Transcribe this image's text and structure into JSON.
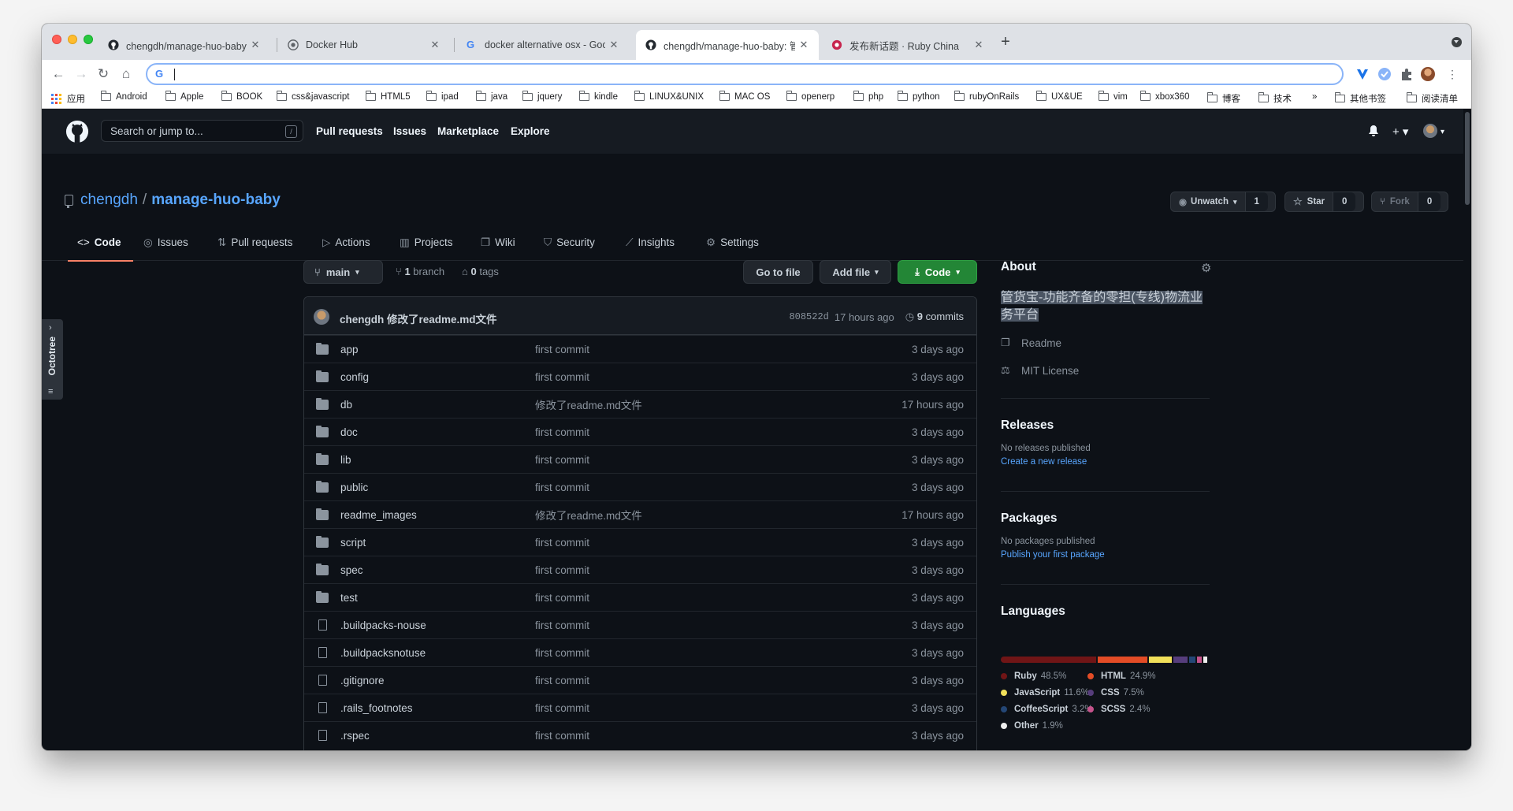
{
  "browser": {
    "tabs": [
      {
        "title": "chengdh/manage-huo-baby: 管货宝",
        "icon": "github-icon",
        "active": false
      },
      {
        "title": "Docker Hub",
        "icon": "docker-icon",
        "active": false
      },
      {
        "title": "docker alternative osx - Google",
        "icon": "google-icon",
        "active": false
      },
      {
        "title": "chengdh/manage-huo-baby: 管货宝",
        "icon": "github-icon",
        "active": true
      },
      {
        "title": "发布新话题 · Ruby China",
        "icon": "ruby-china-icon",
        "active": false
      }
    ],
    "new_tab": "+",
    "address_value": "",
    "bookmarks": [
      "应用",
      "Android",
      "Apple",
      "BOOK",
      "css&javascript",
      "HTML5",
      "ipad",
      "java",
      "jquery",
      "kindle",
      "LINUX&UNIX",
      "MAC OS",
      "openerp",
      "php",
      "python",
      "rubyOnRails",
      "UX&UE",
      "vim",
      "xbox360",
      "博客",
      "技术"
    ],
    "bookmarks_overflow": "»",
    "other_bookmarks": "其他书签",
    "reading_list": "阅读清单"
  },
  "gh": {
    "search_placeholder": "Search or jump to...",
    "search_key": "/",
    "nav": [
      "Pull requests",
      "Issues",
      "Marketplace",
      "Explore"
    ]
  },
  "repo": {
    "owner": "chengdh",
    "sep": "/",
    "name": "manage-huo-baby",
    "unwatch_label": "Unwatch",
    "watch_count": "1",
    "star_label": "Star",
    "star_count": "0",
    "fork_label": "Fork",
    "fork_count": "0",
    "tabs": [
      "Code",
      "Issues",
      "Pull requests",
      "Actions",
      "Projects",
      "Wiki",
      "Security",
      "Insights",
      "Settings"
    ]
  },
  "octotree": {
    "label": "Octotree"
  },
  "toolbar": {
    "branch": "main",
    "branch_count": "1",
    "branch_word": "branch",
    "tag_count": "0",
    "tag_word": "tags",
    "go_to_file": "Go to file",
    "add_file": "Add file",
    "code": "Code"
  },
  "commit": {
    "author": "chengdh",
    "message": "修改了readme.md文件",
    "sha": "808522d",
    "time": "17 hours ago",
    "count": "9",
    "count_word": "commits"
  },
  "files": [
    {
      "name": "app",
      "type": "dir",
      "message": "first commit",
      "age": "3 days ago"
    },
    {
      "name": "config",
      "type": "dir",
      "message": "first commit",
      "age": "3 days ago"
    },
    {
      "name": "db",
      "type": "dir",
      "message": "修改了readme.md文件",
      "age": "17 hours ago"
    },
    {
      "name": "doc",
      "type": "dir",
      "message": "first commit",
      "age": "3 days ago"
    },
    {
      "name": "lib",
      "type": "dir",
      "message": "first commit",
      "age": "3 days ago"
    },
    {
      "name": "public",
      "type": "dir",
      "message": "first commit",
      "age": "3 days ago"
    },
    {
      "name": "readme_images",
      "type": "dir",
      "message": "修改了readme.md文件",
      "age": "17 hours ago"
    },
    {
      "name": "script",
      "type": "dir",
      "message": "first commit",
      "age": "3 days ago"
    },
    {
      "name": "spec",
      "type": "dir",
      "message": "first commit",
      "age": "3 days ago"
    },
    {
      "name": "test",
      "type": "dir",
      "message": "first commit",
      "age": "3 days ago"
    },
    {
      "name": ".buildpacks-nouse",
      "type": "file",
      "message": "first commit",
      "age": "3 days ago"
    },
    {
      "name": ".buildpacksnotuse",
      "type": "file",
      "message": "first commit",
      "age": "3 days ago"
    },
    {
      "name": ".gitignore",
      "type": "file",
      "message": "first commit",
      "age": "3 days ago"
    },
    {
      "name": ".rails_footnotes",
      "type": "file",
      "message": "first commit",
      "age": "3 days ago"
    },
    {
      "name": ".rspec",
      "type": "file",
      "message": "first commit",
      "age": "3 days ago"
    }
  ],
  "about": {
    "title": "About",
    "description": "管货宝-功能齐备的零担(专线)物流业务平台",
    "readme": "Readme",
    "license": "MIT License"
  },
  "releases": {
    "title": "Releases",
    "none": "No releases published",
    "link": "Create a new release"
  },
  "packages": {
    "title": "Packages",
    "none": "No packages published",
    "link": "Publish your first package"
  },
  "languages": {
    "title": "Languages",
    "items": [
      {
        "name": "Ruby",
        "pct": "48.5%",
        "value": 48.5,
        "color": "#701516"
      },
      {
        "name": "HTML",
        "pct": "24.9%",
        "value": 24.9,
        "color": "#e34c26"
      },
      {
        "name": "JavaScript",
        "pct": "11.6%",
        "value": 11.6,
        "color": "#f1e05a"
      },
      {
        "name": "CSS",
        "pct": "7.5%",
        "value": 7.5,
        "color": "#563d7c"
      },
      {
        "name": "CoffeeScript",
        "pct": "3.2%",
        "value": 3.2,
        "color": "#244776"
      },
      {
        "name": "SCSS",
        "pct": "2.4%",
        "value": 2.4,
        "color": "#c6538c"
      },
      {
        "name": "Other",
        "pct": "1.9%",
        "value": 1.9,
        "color": "#ededed"
      }
    ]
  }
}
